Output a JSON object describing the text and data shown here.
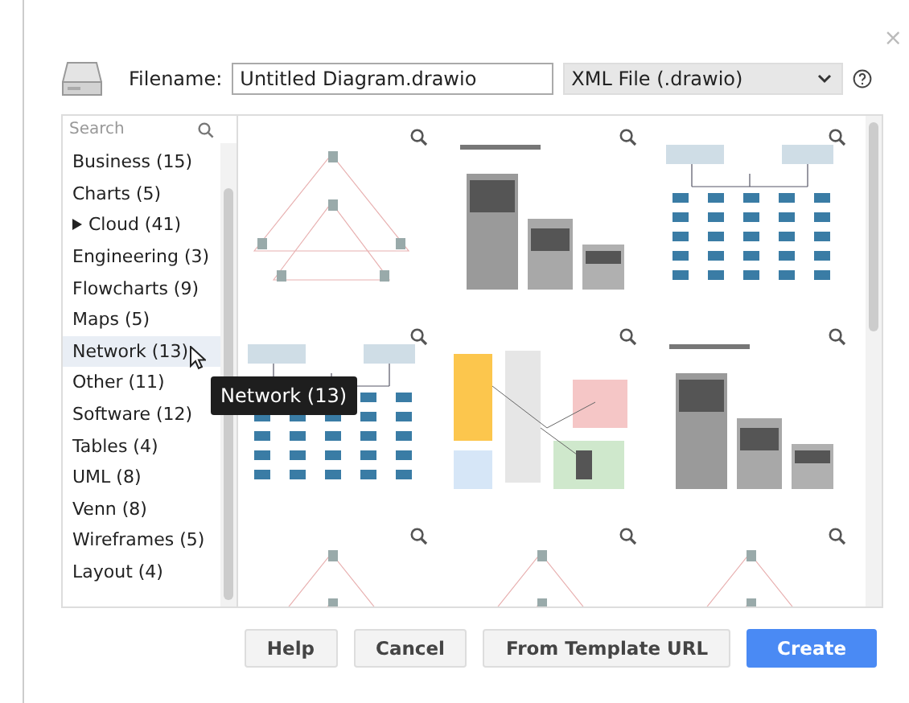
{
  "close": "×",
  "filename": {
    "label": "Filename:",
    "value": "Untitled Diagram.drawio"
  },
  "format": {
    "value": "XML File (.drawio)"
  },
  "search": {
    "placeholder": "Search"
  },
  "categories": [
    {
      "label": "Business (15)",
      "expandable": false,
      "hovered": false
    },
    {
      "label": "Charts (5)",
      "expandable": false,
      "hovered": false
    },
    {
      "label": "Cloud (41)",
      "expandable": true,
      "hovered": false
    },
    {
      "label": "Engineering (3)",
      "expandable": false,
      "hovered": false
    },
    {
      "label": "Flowcharts (9)",
      "expandable": false,
      "hovered": false
    },
    {
      "label": "Maps (5)",
      "expandable": false,
      "hovered": false
    },
    {
      "label": "Network (13)",
      "expandable": false,
      "hovered": true
    },
    {
      "label": "Other (11)",
      "expandable": false,
      "hovered": false
    },
    {
      "label": "Software (12)",
      "expandable": false,
      "hovered": false
    },
    {
      "label": "Tables (4)",
      "expandable": false,
      "hovered": false
    },
    {
      "label": "UML (8)",
      "expandable": false,
      "hovered": false
    },
    {
      "label": "Venn (8)",
      "expandable": false,
      "hovered": false
    },
    {
      "label": "Wireframes (5)",
      "expandable": false,
      "hovered": false
    },
    {
      "label": "Layout (4)",
      "expandable": false,
      "hovered": false
    }
  ],
  "tooltip": {
    "text": "Network (13)"
  },
  "templates": [
    {
      "kind": "sketch"
    },
    {
      "kind": "rack"
    },
    {
      "kind": "tree"
    },
    {
      "kind": "tree"
    },
    {
      "kind": "regions"
    },
    {
      "kind": "rack"
    },
    {
      "kind": "sketch"
    },
    {
      "kind": "sketch"
    },
    {
      "kind": "sketch"
    }
  ],
  "buttons": [
    {
      "label": "Help",
      "kind": "plain"
    },
    {
      "label": "Cancel",
      "kind": "plain"
    },
    {
      "label": "From Template URL",
      "kind": "plain"
    },
    {
      "label": "Create",
      "kind": "primary"
    }
  ]
}
